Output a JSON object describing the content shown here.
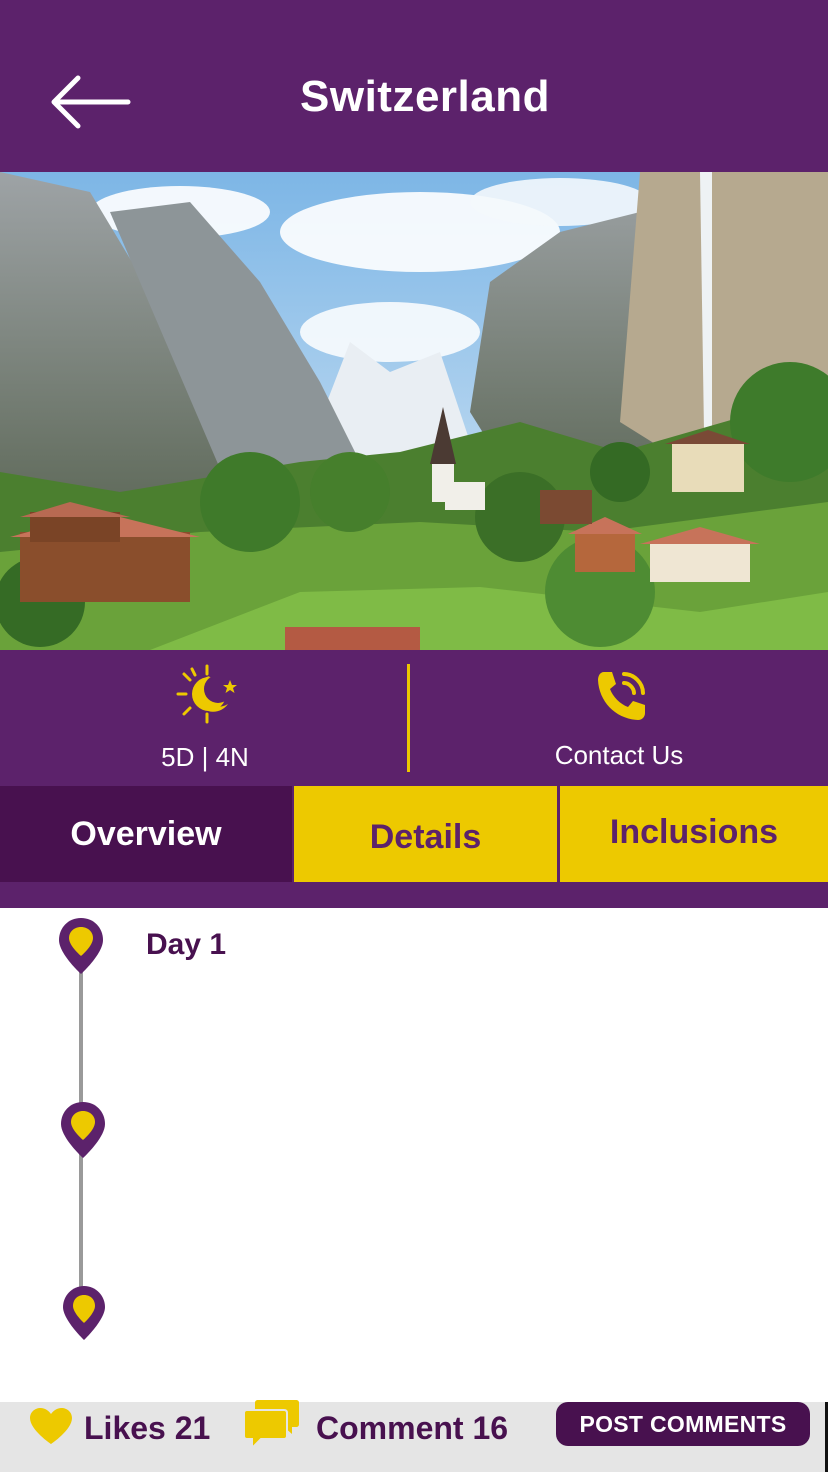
{
  "header": {
    "title": "Switzerland",
    "back_icon": "arrow-left-icon"
  },
  "hero": {
    "alt": "Swiss alpine valley village with church steeple, cliffs and waterfall"
  },
  "info": {
    "duration": {
      "icon": "sun-moon-icon",
      "label": "5D | 4N"
    },
    "contact": {
      "icon": "phone-ringing-icon",
      "label": "Contact Us"
    }
  },
  "tabs": [
    {
      "label": "Overview",
      "active": true
    },
    {
      "label": "Details",
      "active": false
    },
    {
      "label": "Inclusions",
      "active": false
    }
  ],
  "timeline": {
    "days": [
      {
        "label": "Day 1"
      },
      {
        "label": ""
      },
      {
        "label": ""
      }
    ]
  },
  "footer": {
    "likes_label": "Likes 21",
    "comments_label": "Comment 16",
    "post_button": "POST COMMENTS"
  },
  "colors": {
    "primary": "#5c226b",
    "primary_dark": "#48114f",
    "accent": "#edc900"
  }
}
